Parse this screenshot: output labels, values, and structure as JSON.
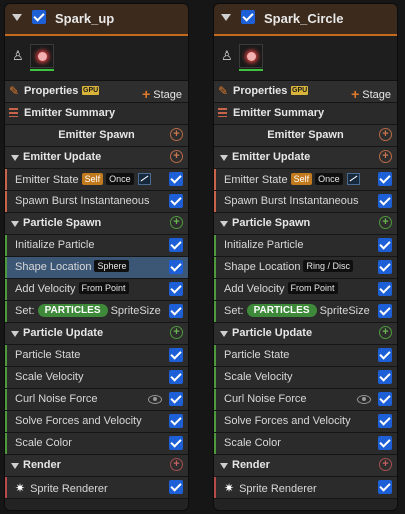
{
  "emitters": [
    {
      "name": "Spark_up",
      "properties": {
        "label": "Properties",
        "gpu_badge": "GPU",
        "stage_label": "Stage"
      },
      "summary_label": "Emitter Summary",
      "emitter_spawn": "Emitter Spawn",
      "emitter_update": {
        "label": "Emitter Update",
        "emitter_state": {
          "label": "Emitter State",
          "tag_self": "Self",
          "tag_once": "Once"
        },
        "spawn_burst": "Spawn Burst Instantaneous"
      },
      "particle_spawn": {
        "label": "Particle Spawn",
        "initialize": "Initialize Particle",
        "shape_location": {
          "label": "Shape Location",
          "tag": "Sphere"
        },
        "add_velocity": {
          "label": "Add Velocity",
          "tag": "From Point"
        },
        "set": {
          "label": "Set:",
          "badge": "PARTICLES",
          "value": "SpriteSize"
        }
      },
      "particle_update": {
        "label": "Particle Update",
        "items": [
          "Particle State",
          "Scale Velocity",
          "Curl Noise Force",
          "Solve Forces and Velocity",
          "Scale Color"
        ]
      },
      "render": {
        "label": "Render",
        "sprite_renderer": "Sprite Renderer"
      }
    },
    {
      "name": "Spark_Circle",
      "properties": {
        "label": "Properties",
        "gpu_badge": "GPU",
        "stage_label": "Stage"
      },
      "summary_label": "Emitter Summary",
      "emitter_spawn": "Emitter Spawn",
      "emitter_update": {
        "label": "Emitter Update",
        "emitter_state": {
          "label": "Emitter State",
          "tag_self": "Self",
          "tag_once": "Once"
        },
        "spawn_burst": "Spawn Burst Instantaneous"
      },
      "particle_spawn": {
        "label": "Particle Spawn",
        "initialize": "Initialize Particle",
        "shape_location": {
          "label": "Shape Location",
          "tag": "Ring / Disc"
        },
        "add_velocity": {
          "label": "Add Velocity",
          "tag": "From Point"
        },
        "set": {
          "label": "Set:",
          "badge": "PARTICLES",
          "value": "SpriteSize"
        }
      },
      "particle_update": {
        "label": "Particle Update",
        "items": [
          "Particle State",
          "Scale Velocity",
          "Curl Noise Force",
          "Solve Forces and Velocity",
          "Scale Color"
        ]
      },
      "render": {
        "label": "Render",
        "sprite_renderer": "Sprite Renderer"
      }
    }
  ],
  "colors": {
    "accent_orange": "#c46a1e",
    "update_accent": "#c8644a",
    "spawn_accent": "#4f9a3c",
    "render_accent": "#b84a4a",
    "selection": "#3c5676",
    "checkbox": "#1c5fd6"
  },
  "icons": [
    "collapse-triangle-icon",
    "enable-checkbox",
    "lock-icon",
    "preview-thumbnail-icon",
    "pencil-icon",
    "add-plus-icon",
    "list-icon",
    "curve-graph-icon",
    "eye-icon",
    "sprite-star-icon"
  ]
}
